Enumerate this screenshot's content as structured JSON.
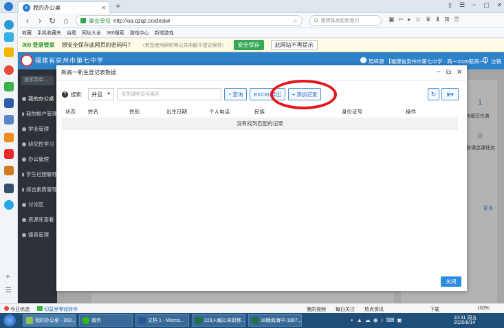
{
  "browser": {
    "tab_title": "我的办公桌",
    "site_name": "事业单位",
    "url": "http://oa.qzqz.cn/desk#",
    "search_placeholder": "董明珠发起新题约",
    "bookmarks": [
      "收藏",
      "手机收藏夹",
      "谷歌",
      "网址大全",
      "360搜索",
      "游戏中心",
      "新增游戏"
    ],
    "save_prompt": {
      "brand": "360 登录管家",
      "question": "想安全保存此网页的密码吗？",
      "note": "（若您使用网吧等公共电脑不建议保存）",
      "save_label": "安全保存",
      "never_label": "此网站不再提示"
    }
  },
  "site": {
    "header_title": "福建省泉州市第七中学",
    "user_name": "周梓源",
    "user_org": "【福建省泉州市第七中学 · 高一2020新高一】",
    "logout_label": "注销",
    "search_placeholder": "搜索菜单...",
    "sidebar_items": [
      "我的办公桌",
      "我的帐户管理",
      "学业管理",
      "研究性学习",
      "办公管理",
      "学生社团管理",
      "综合素质管理",
      "讨论区",
      "资源库查看",
      "德育管理"
    ],
    "bg_card_texts": {
      "count1": "1",
      "label1": "待填写任务",
      "count2": "0",
      "label2": "修课选课任务",
      "more": "更多"
    }
  },
  "modal": {
    "title": "新高一新生登记表数据",
    "search_label": "搜索:",
    "search_mode": "并且",
    "search_placeholder": "多关键字逗号隔开",
    "query_label": "查询",
    "export_label": "EXCEL导出",
    "add_label": "添加记录",
    "columns": [
      "状态",
      "姓名",
      "性别",
      "出生日期",
      "个人电话",
      "民族",
      "身份证号",
      "操作"
    ],
    "empty_text": "没有找到匹配的记录",
    "close_label": "关闭"
  },
  "statusbar": {
    "left1": "今日优选",
    "left2": "切莫里零钱转存",
    "right": [
      "我的视频",
      "每日关注",
      "热点资讯",
      "下载"
    ],
    "zoom": "100%"
  },
  "taskbar": {
    "tasks": [
      "我的办公桌 - 360...",
      "微信",
      "文档 1 - Micros...",
      "229入编以来职称...",
      "18晚城海中-1807..."
    ],
    "time": "10:31 周五",
    "date": "2020/8/14"
  },
  "colors": {
    "header_blue": "#2d82c9",
    "sidebar_dark": "#2e3238",
    "highlight_red": "#e5161a",
    "button_blue": "#2d8ce3"
  }
}
